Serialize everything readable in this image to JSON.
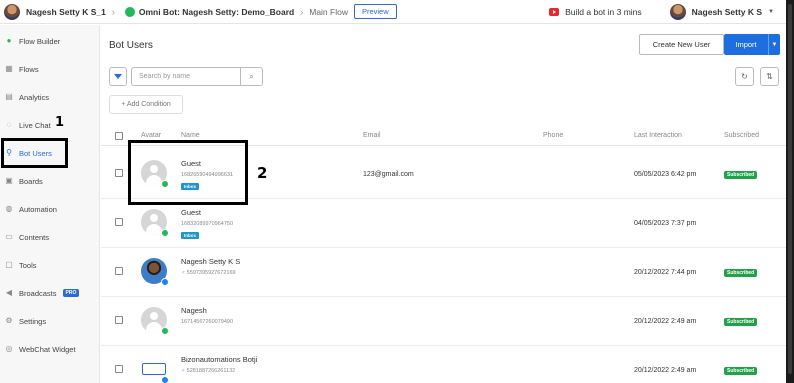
{
  "topbar": {
    "workspace_user": "Nagesh Setty K S_1",
    "bot_title": "Omni Bot: Nagesh Setty: Demo_Board",
    "flow_name": "Main Flow",
    "preview_label": "Preview",
    "build_bot_label": "Build a bot in 3 mins",
    "account_name": "Nagesh Setty K S"
  },
  "sidebar": {
    "items": [
      {
        "label": "Flow Builder",
        "icon": "flow-builder-icon"
      },
      {
        "label": "Flows",
        "icon": "flows-icon"
      },
      {
        "label": "Analytics",
        "icon": "analytics-icon"
      },
      {
        "label": "Live Chat",
        "icon": "live-chat-icon"
      },
      {
        "label": "Bot Users",
        "icon": "bot-users-icon"
      },
      {
        "label": "Boards",
        "icon": "boards-icon"
      },
      {
        "label": "Automation",
        "icon": "automation-icon"
      },
      {
        "label": "Contents",
        "icon": "contents-icon"
      },
      {
        "label": "Tools",
        "icon": "tools-icon"
      },
      {
        "label": "Broadcasts",
        "icon": "broadcasts-icon",
        "badge": "PRO"
      },
      {
        "label": "Settings",
        "icon": "settings-icon"
      },
      {
        "label": "WebChat Widget",
        "icon": "webchat-widget-icon"
      }
    ],
    "active_index": 4
  },
  "annotations": {
    "one": "1",
    "two": "2"
  },
  "main": {
    "title": "Bot Users",
    "create_button": "Create New User",
    "import_button": "Import",
    "search_placeholder": "Search by name",
    "add_condition": "+ Add Condition"
  },
  "table": {
    "headers": [
      "Avatar",
      "Name",
      "Email",
      "Phone",
      "Last Interaction",
      "Subscribed"
    ],
    "rows": [
      {
        "name": "Guest",
        "id": "16826590494996631",
        "tag": "Inbox",
        "email": "123@gmail.com",
        "phone": "",
        "last": "05/05/2023 6:42 pm",
        "subscribed": "Subscribed",
        "avatar": "placeholder",
        "channel": "whatsapp"
      },
      {
        "name": "Guest",
        "id": "16832089970964750",
        "tag": "Inbox",
        "email": "",
        "phone": "",
        "last": "04/05/2023 7:37 pm",
        "subscribed": "",
        "avatar": "placeholder",
        "channel": "whatsapp"
      },
      {
        "name": "Nagesh Setty K S",
        "id": "5597395927672169",
        "tag": "",
        "email": "",
        "phone": "",
        "last": "20/12/2022 7:44 pm",
        "subscribed": "Subscribed",
        "avatar": "photo",
        "channel": "messenger"
      },
      {
        "name": "Nagesh",
        "id": "16714567260079490",
        "tag": "",
        "email": "",
        "phone": "",
        "last": "20/12/2022 2:49 am",
        "subscribed": "Subscribed",
        "avatar": "placeholder",
        "channel": "whatsapp"
      },
      {
        "name": "Bizonautomations Botji",
        "id": "5281887266261132",
        "tag": "",
        "email": "",
        "phone": "",
        "last": "20/12/2022 2:49 am",
        "subscribed": "Subscribed",
        "avatar": "logo",
        "channel": "messenger"
      }
    ]
  },
  "colors": {
    "accent": "#1f6ee0",
    "subscribed": "#23a04a",
    "inbox": "#2196c9",
    "whatsapp": "#25b857",
    "messenger": "#1a82fb"
  }
}
